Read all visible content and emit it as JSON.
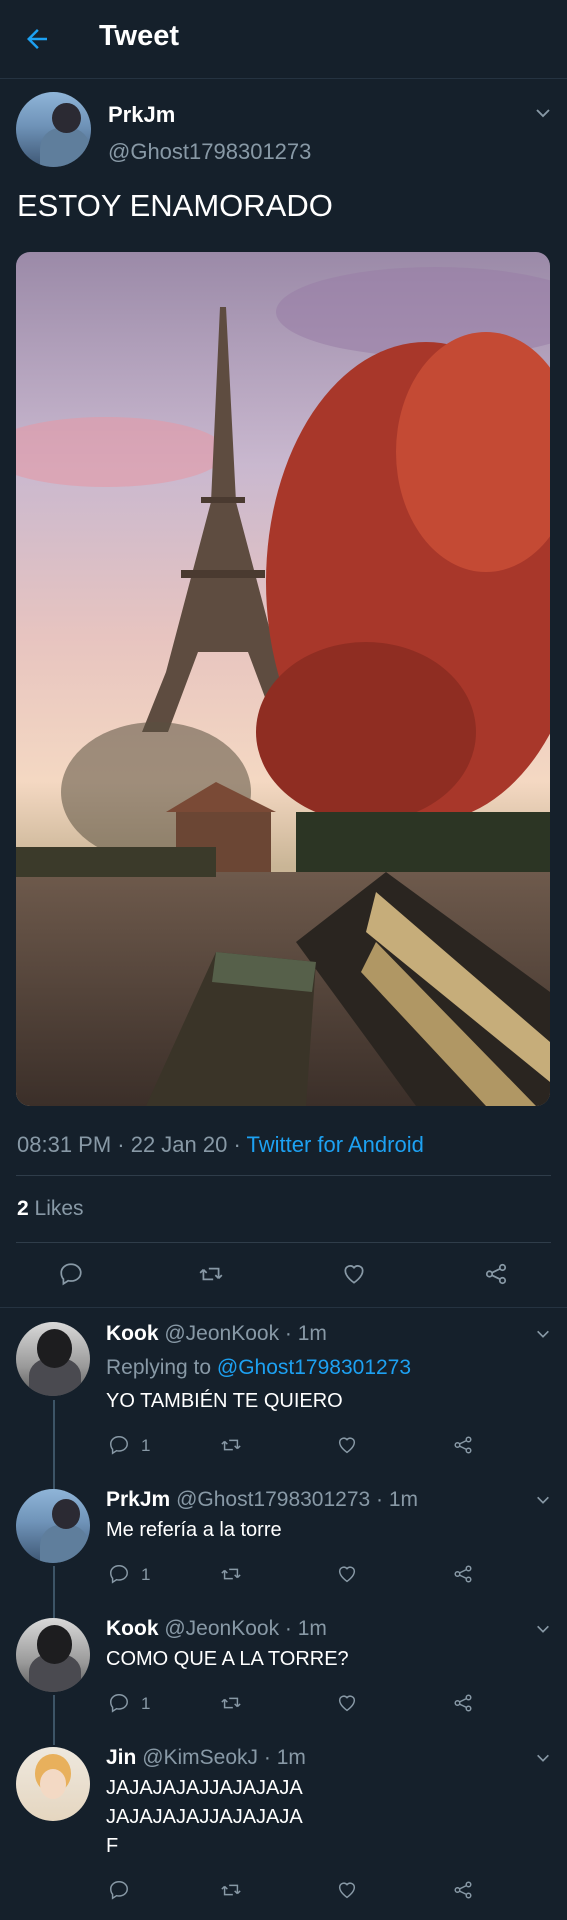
{
  "header": {
    "title": "Tweet",
    "back_icon": "back-arrow-icon"
  },
  "tweet": {
    "name": "PrkJm",
    "handle": "@Ghost1798301273",
    "text": "ESTOY ENAMORADO",
    "time": "08:31 PM · 22 Jan 20 · ",
    "source": "Twitter for Android",
    "likes_count": "2",
    "likes_label": " Likes"
  },
  "replies": [
    {
      "name": "Kook",
      "handle_time": "@JeonKook · 1m",
      "replying_label": "Replying to ",
      "replying_to": "@Ghost1798301273",
      "text": "YO TAMBIÉN TE QUIERO",
      "reply_count": "1"
    },
    {
      "name": "PrkJm",
      "handle_time": "@Ghost1798301273 · 1m",
      "text": "Me refería a la torre",
      "reply_count": "1"
    },
    {
      "name": "Kook",
      "handle_time": "@JeonKook · 1m",
      "text": "COMO QUE A LA TORRE?",
      "reply_count": "1"
    },
    {
      "name": "Jin",
      "handle_time": "@KimSeokJ · 1m",
      "text_line1": "JAJAJAJAJJAJAJAJA",
      "text_line2": "JAJAJAJAJJAJAJAJA",
      "text_line3": "F"
    }
  ],
  "colors": {
    "background": "#15202b",
    "accent": "#1da1f2",
    "secondary_text": "#8899a6",
    "divider": "#2f3d4a"
  }
}
